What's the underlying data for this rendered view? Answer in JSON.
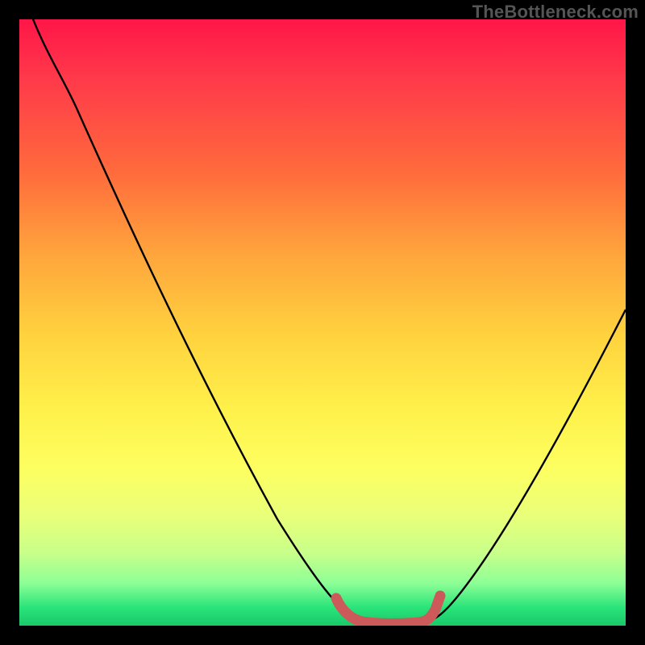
{
  "watermark": "TheBottleneck.com",
  "chart_data": {
    "type": "line",
    "title": "",
    "xlabel": "",
    "ylabel": "",
    "xlim": [
      0,
      100
    ],
    "ylim": [
      0,
      100
    ],
    "series": [
      {
        "name": "bottleneck-curve",
        "color": "#000000",
        "x": [
          0,
          6,
          12,
          18,
          24,
          30,
          36,
          42,
          48,
          52,
          55,
          58,
          62,
          66,
          70,
          76,
          82,
          88,
          94,
          100
        ],
        "y": [
          106,
          93,
          81,
          68,
          56,
          44,
          33,
          23,
          13,
          7,
          3.5,
          1.5,
          0.2,
          0.2,
          1.5,
          6,
          14,
          25,
          38,
          52
        ]
      },
      {
        "name": "optimal-range-marker",
        "color": "#cc5a5a",
        "x": [
          52,
          54,
          56,
          58,
          60,
          62,
          64,
          66,
          67
        ],
        "y": [
          4.5,
          2.2,
          1.3,
          0.9,
          0.8,
          0.8,
          0.9,
          1.6,
          4.2
        ]
      }
    ],
    "background_gradient": {
      "top": "#ff1648",
      "middle": "#ffe040",
      "bottom": "#19c86a"
    },
    "notes": "Vertical gradient from red (high bottleneck) through yellow to green (optimal). Black V-shaped curve shows bottleneck severity versus component balance; red highlight marks the near-zero optimal zone around x≈55–67. No visible axis ticks or numeric labels."
  }
}
